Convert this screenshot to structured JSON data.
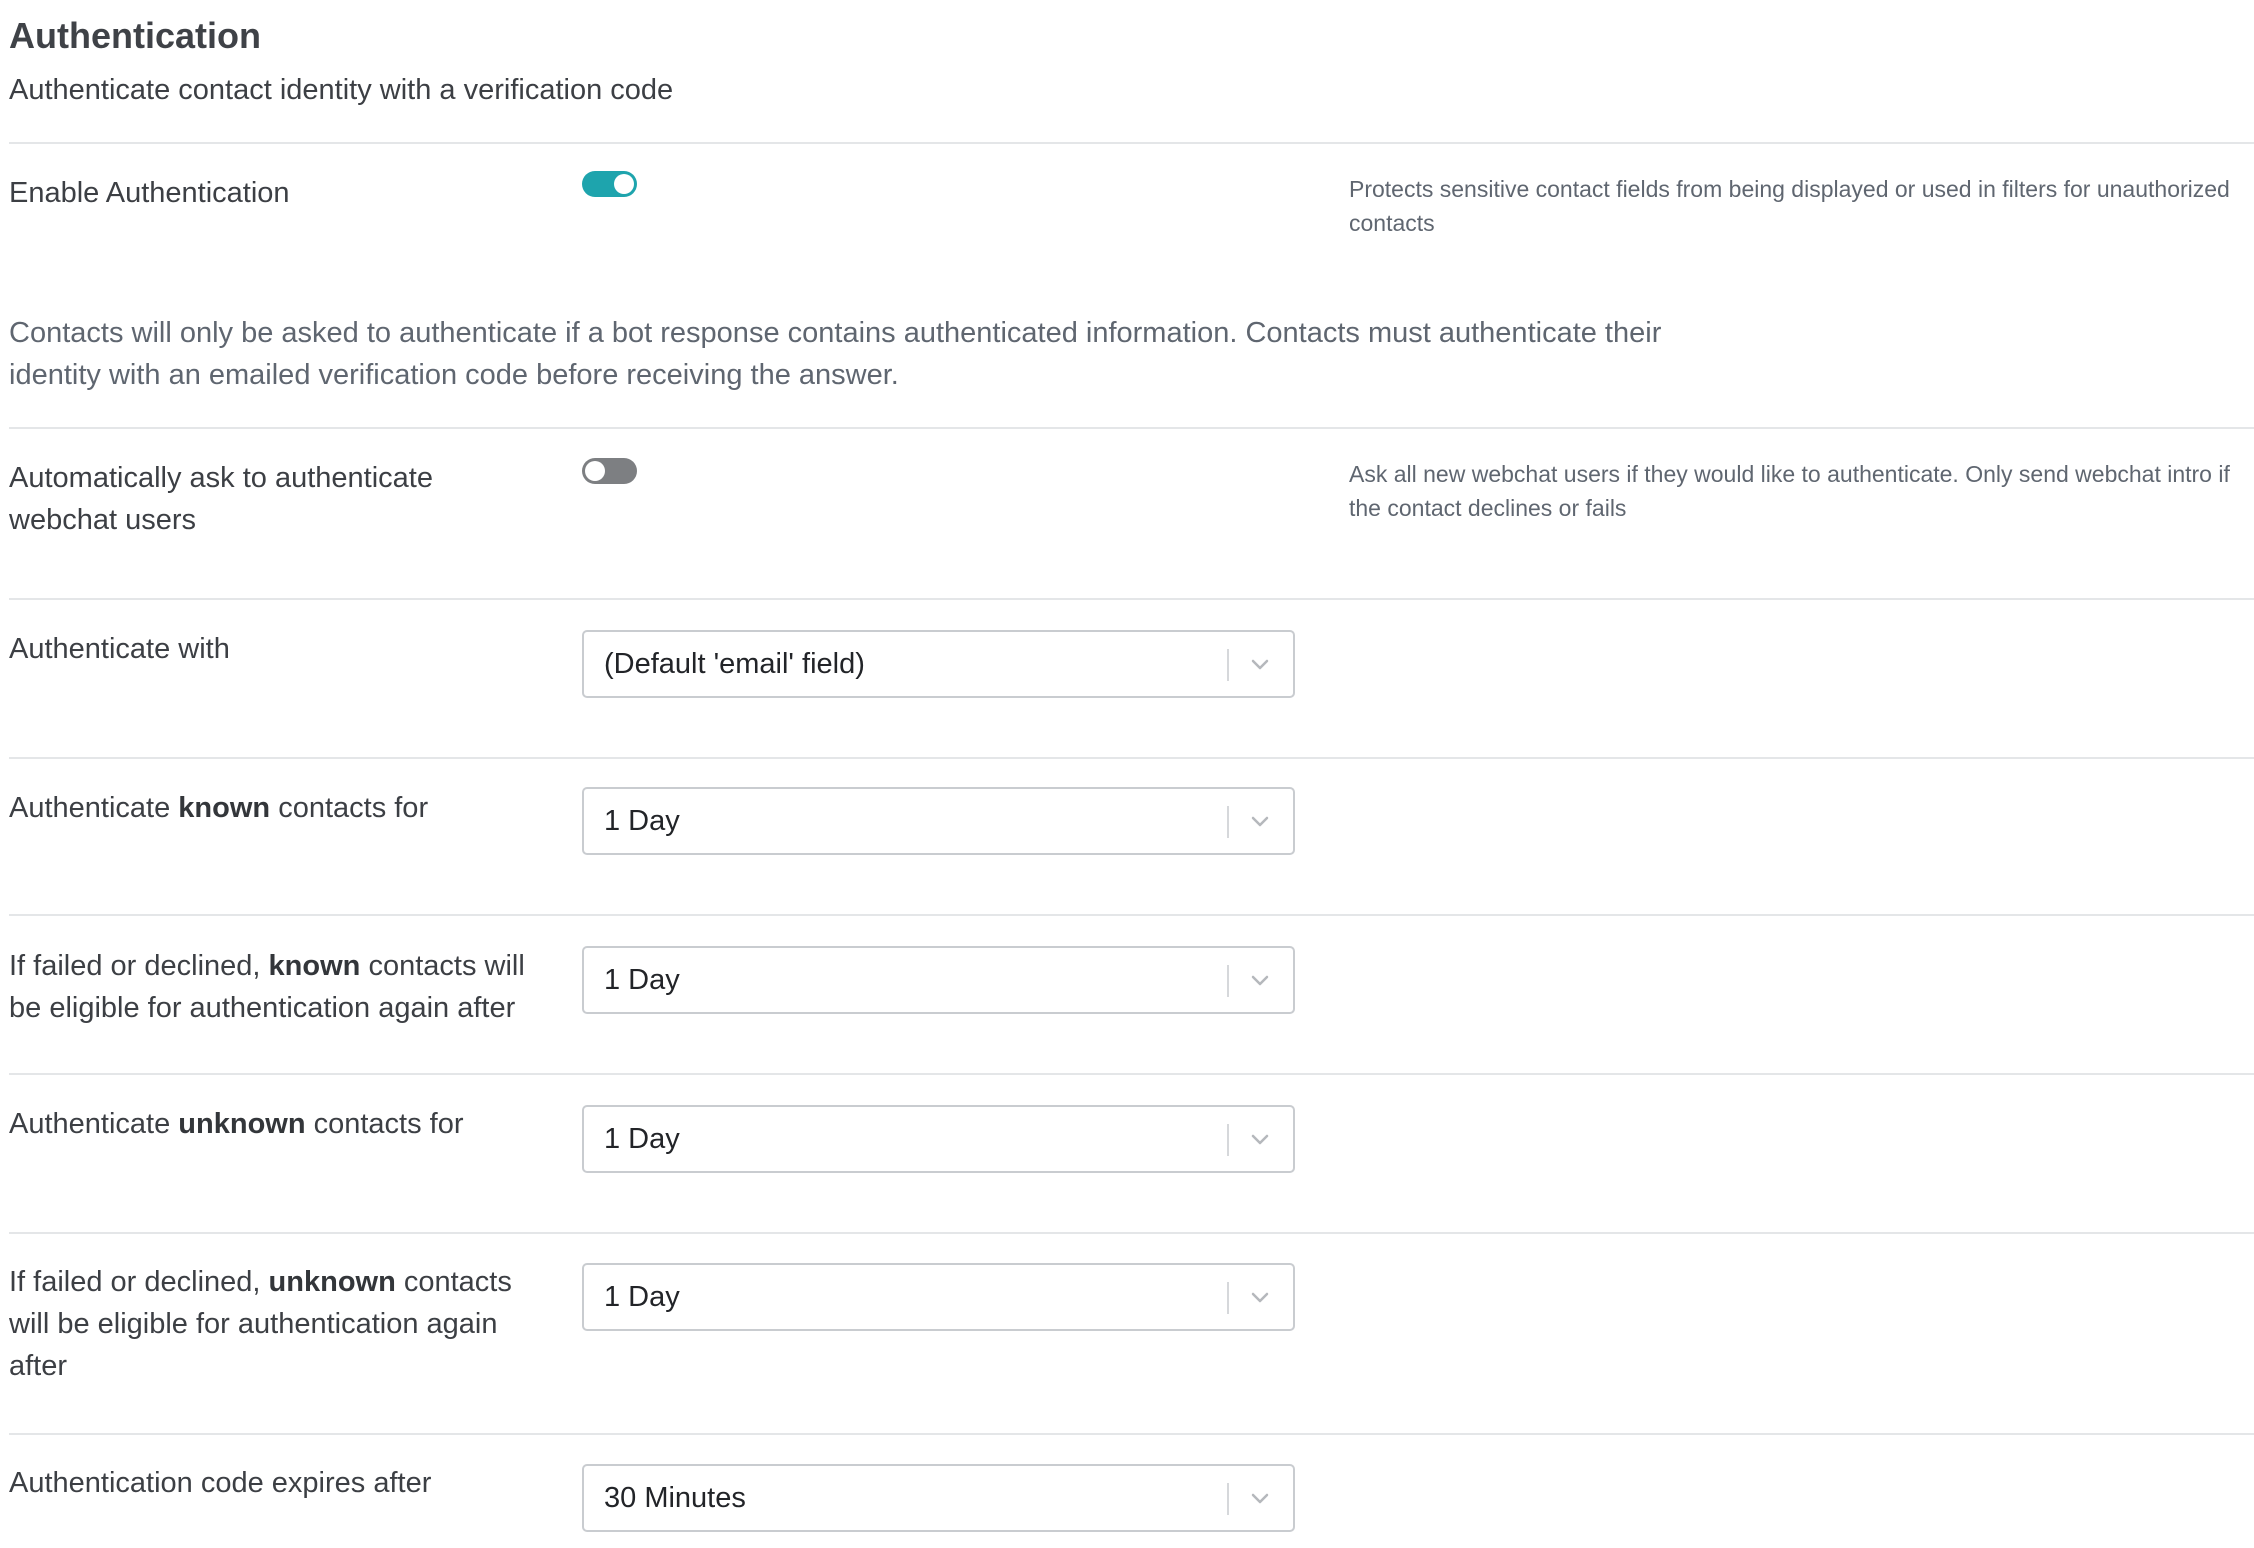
{
  "header": {
    "title": "Authentication",
    "subtitle": "Authenticate contact identity with a verification code"
  },
  "enable_auth": {
    "label": "Enable Authentication",
    "enabled": true,
    "help": "Protects sensitive contact fields from being displayed or used in filters for unauthorized contacts"
  },
  "info_text": "Contacts will only be asked to authenticate if a bot response contains authenticated information. Contacts must authenticate their identity with an emailed verification code before receiving the answer.",
  "auto_ask": {
    "label": "Automatically ask to authenticate webchat users",
    "enabled": false,
    "help": "Ask all new webchat users if they would like to authenticate. Only send webchat intro if the contact declines or fails"
  },
  "authenticate_with": {
    "label": "Authenticate with",
    "value": "(Default 'email' field)"
  },
  "known_duration": {
    "label_pre": "Authenticate ",
    "label_bold": "known",
    "label_post": " contacts for",
    "value": "1 Day"
  },
  "known_retry": {
    "label_pre": "If failed or declined, ",
    "label_bold": "known",
    "label_post": " contacts will be eligible for authentication again after",
    "value": "1 Day"
  },
  "unknown_duration": {
    "label_pre": "Authenticate ",
    "label_bold": "unknown",
    "label_post": " contacts for",
    "value": "1 Day"
  },
  "unknown_retry": {
    "label_pre": "If failed or declined, ",
    "label_bold": "unknown",
    "label_post": " contacts will be eligible for authentication again after",
    "value": "1 Day"
  },
  "code_expiry": {
    "label": "Authentication code expires after",
    "value": "30 Minutes"
  },
  "icons": {
    "select_arrow": "chevron-down-icon"
  },
  "colors": {
    "toggle_on": "#1ea4ad",
    "toggle_off": "#7d7f82",
    "divider": "#e4e6e8"
  }
}
